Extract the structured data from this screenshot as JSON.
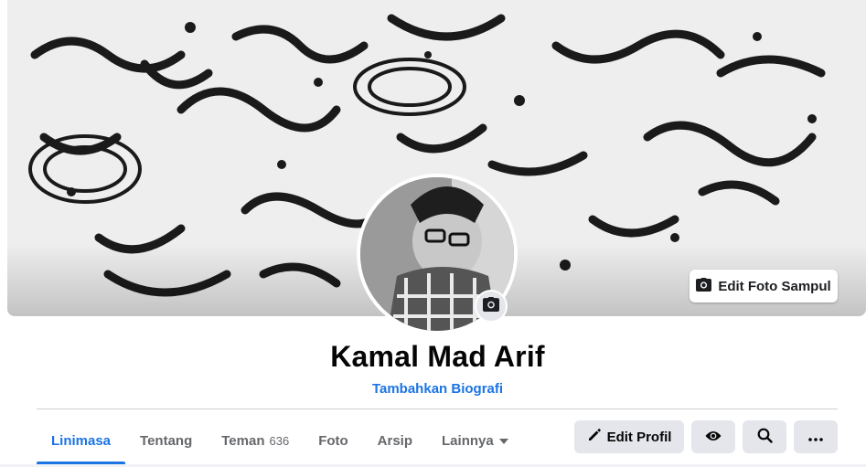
{
  "cover": {
    "edit_label": "Edit Foto Sampul",
    "icon": "camera-icon"
  },
  "profile": {
    "name": "Kamal Mad Arif",
    "bio_link": "Tambahkan Biografi",
    "avatar_icon": "camera-icon"
  },
  "tabs": [
    {
      "label": "Linimasa",
      "active": true
    },
    {
      "label": "Tentang"
    },
    {
      "label": "Teman",
      "count": "636"
    },
    {
      "label": "Foto"
    },
    {
      "label": "Arsip"
    },
    {
      "label": "Lainnya",
      "icon": "caret-down-icon"
    }
  ],
  "actions": {
    "edit_profile_label": "Edit Profil",
    "icons": [
      "pencil-icon",
      "eye-icon",
      "search-icon",
      "more-icon"
    ]
  },
  "colors": {
    "accent": "#1b74e4",
    "button_bg": "#e4e6eb",
    "text": "#050505",
    "secondary_text": "#65676b"
  }
}
